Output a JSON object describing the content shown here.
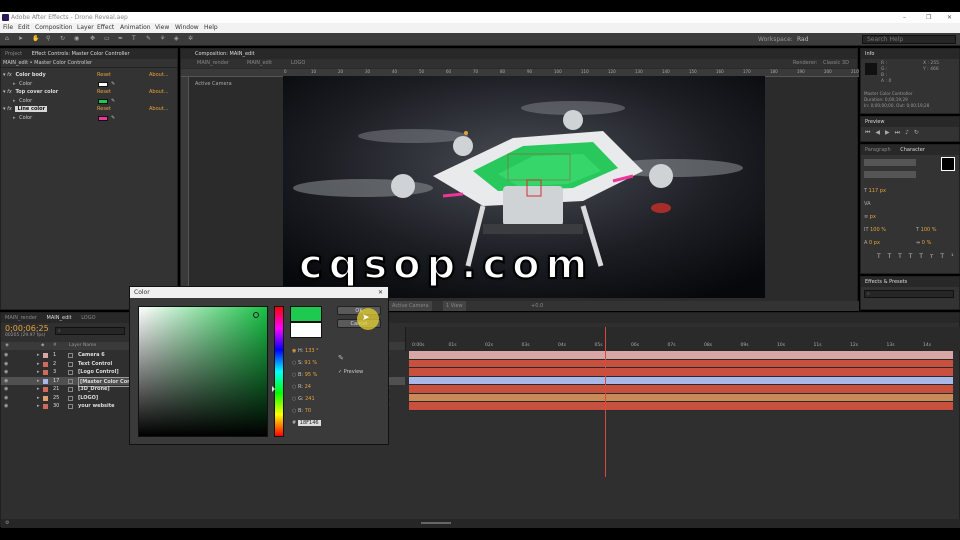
{
  "window": {
    "title": "Adobe After Effects - Drone Reveal.aep"
  },
  "menu": [
    "File",
    "Edit",
    "Composition",
    "Layer",
    "Effect",
    "Animation",
    "View",
    "Window",
    "Help"
  ],
  "toolbar": {
    "workspace_label": "Workspace:",
    "workspace_value": "Rad",
    "search_placeholder": "Search Help"
  },
  "effect_controls": {
    "tabs": [
      "Project",
      "Effect Controls: Master Color Controller"
    ],
    "breadcrumb": "MAIN_edit • Master Color Controller",
    "effects": [
      {
        "name": "Color body",
        "reset": "Reset",
        "about": "About...",
        "param": "Color",
        "swatch": "#ffffff"
      },
      {
        "name": "Top cover color",
        "reset": "Reset",
        "about": "About...",
        "param": "Color",
        "swatch": "#1ec94f"
      },
      {
        "name": "Line color",
        "reset": "Reset",
        "about": "About...",
        "param": "Color",
        "swatch": "#f0349a"
      }
    ]
  },
  "composition": {
    "tab": "Composition: MAIN_edit",
    "crumbs": [
      "MAIN_render",
      "MAIN_edit",
      "LOGO"
    ],
    "renderer_label": "Renderer:",
    "renderer_value": "Classic 3D",
    "view_label": "Active Camera",
    "ruler_ticks": [
      "0",
      "10",
      "20",
      "30",
      "40",
      "50",
      "60",
      "70",
      "80",
      "90",
      "100",
      "110",
      "120",
      "130",
      "140",
      "150",
      "160",
      "170",
      "180",
      "190",
      "200",
      "210",
      "220",
      "230"
    ],
    "watermark": "cqsop.com",
    "footer_camera": "Active Camera",
    "footer_view": "1 View",
    "footer_offset": "+0.0"
  },
  "info_panel": {
    "tab": "Info",
    "r": "R :",
    "g": "G :",
    "b": "B :",
    "a": "A : 0",
    "x": "X : 255",
    "y": "Y : 466",
    "layer": "Master Color Controller",
    "duration": "Duration: 0;00;19;29",
    "range": "In: 0;00;00;00, Out: 0;00;19;28"
  },
  "preview_panel": {
    "tab": "Preview"
  },
  "character_panel": {
    "tabs": [
      "Paragraph",
      "Character"
    ],
    "size": "117 px",
    "tracking": "px",
    "scale_v": "100 %",
    "scale_h": "100 %",
    "baseline": "0 px",
    "tsume": "0 %"
  },
  "effects_presets": {
    "tab": "Effects & Presets",
    "search_placeholder": "⌕"
  },
  "timeline": {
    "tabs": [
      "MAIN_render",
      "MAIN_edit",
      "LOGO"
    ],
    "timecode": "0;00;06;25",
    "frame_info": "00205 (29.97 fps)",
    "search_placeholder": "⌕",
    "col_layer_name": "Layer Name",
    "layers": [
      {
        "num": "1",
        "name": "Camera 6",
        "color": "#d9a6a6",
        "bar": "#d9a6a6",
        "selected": false
      },
      {
        "num": "2",
        "name": "Text Control",
        "color": "#d06a5c",
        "bar": "#c8503f",
        "selected": false
      },
      {
        "num": "3",
        "name": "[Logo Control]",
        "color": "#d06a5c",
        "bar": "#c8503f",
        "selected": false
      },
      {
        "num": "17",
        "name": "[Master Color Cont",
        "color": "#a8b8e8",
        "bar": "#a8b8e8",
        "selected": true
      },
      {
        "num": "21",
        "name": "[3D_Drone]",
        "color": "#d06a5c",
        "bar": "#c8503f",
        "selected": false
      },
      {
        "num": "25",
        "name": "[LOGO]",
        "color": "#e0a070",
        "bar": "#c88a58",
        "selected": false
      },
      {
        "num": "30",
        "name": "your website",
        "color": "#d06a5c",
        "bar": "#c8503f",
        "selected": false
      }
    ],
    "ticks": [
      "0:00s",
      "01s",
      "02s",
      "03s",
      "04s",
      "05s",
      "06s",
      "07s",
      "08s",
      "09s",
      "10s",
      "11s",
      "12s",
      "13s",
      "14s"
    ],
    "playhead_fraction": 0.36
  },
  "color_dialog": {
    "title": "Color",
    "ok_label": "OK",
    "cancel_label": "Cancel",
    "preview_label": "Preview",
    "h_label": "H:",
    "h_value": "133 °",
    "s_label": "S:",
    "s_value": "91 %",
    "b_label": "B:",
    "b_value": "95 %",
    "r_label": "R:",
    "r_value": "24",
    "g_label": "G:",
    "g_value": "241",
    "bb_label": "B:",
    "bb_value": "70",
    "hex_label": "#",
    "hex_value": "18F146",
    "new_color": "#1ec94f",
    "old_color": "#ffffff"
  }
}
